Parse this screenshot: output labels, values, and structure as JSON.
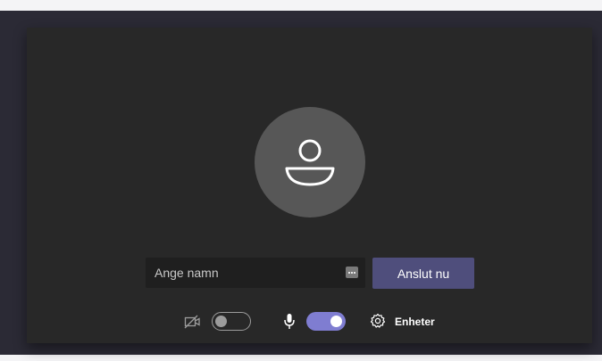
{
  "prejoin": {
    "name_placeholder": "Ange namn",
    "join_label": "Anslut nu",
    "devices_label": "Enheter",
    "camera_enabled": false,
    "microphone_enabled": true
  },
  "icons": {
    "avatar": "person-icon",
    "camera": "camera-off-icon",
    "microphone": "microphone-icon",
    "devices": "gear-icon",
    "input_action": "more-dots-icon"
  },
  "colors": {
    "accent": "#7f7dd1",
    "join_button": "#4f4e7c",
    "panel": "#282828",
    "background": "#2b2a35"
  }
}
